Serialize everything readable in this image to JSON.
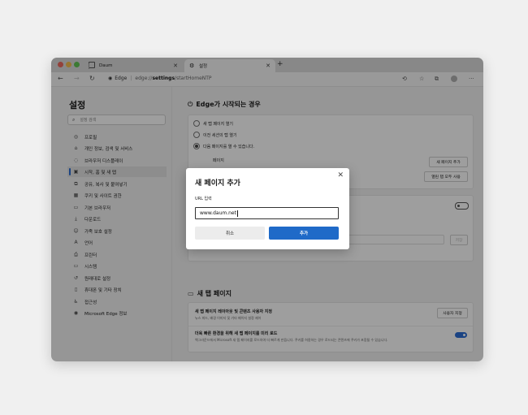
{
  "colors": {
    "accent": "#2b6cd4",
    "primary_button": "#1f6ac8",
    "mac_close": "#ed6a5e",
    "mac_min": "#f5bf4f",
    "mac_max": "#61c554"
  },
  "tabs": [
    {
      "title": "Daum",
      "icon": "daum-icon"
    },
    {
      "title": "설정",
      "icon": "settings-icon"
    }
  ],
  "address": {
    "browser_label": "Edge",
    "url_prefix": "edge://",
    "url_bold": "settings",
    "url_suffix": "/startHomeNTP"
  },
  "sidebar": {
    "title": "설정",
    "search_placeholder": "설정 검색",
    "items": [
      {
        "label": "프로필",
        "icon": "profile-icon"
      },
      {
        "label": "개인 정보, 검색 및 서비스",
        "icon": "lock-icon"
      },
      {
        "label": "브라우저 디스플레이",
        "icon": "display-icon"
      },
      {
        "label": "시작, 홈 및 새 탭",
        "icon": "home-icon"
      },
      {
        "label": "공유, 복사 및 붙여넣기",
        "icon": "share-icon"
      },
      {
        "label": "쿠키 및 사이트 권한",
        "icon": "cookie-icon"
      },
      {
        "label": "기본 브라우저",
        "icon": "browser-icon"
      },
      {
        "label": "다운로드",
        "icon": "download-icon"
      },
      {
        "label": "가족 보호 설정",
        "icon": "family-icon"
      },
      {
        "label": "언어",
        "icon": "language-icon"
      },
      {
        "label": "프린터",
        "icon": "printer-icon"
      },
      {
        "label": "시스템",
        "icon": "system-icon"
      },
      {
        "label": "원래대로 설정",
        "icon": "reset-icon"
      },
      {
        "label": "휴대폰 및 기타 장치",
        "icon": "phone-icon"
      },
      {
        "label": "접근성",
        "icon": "accessibility-icon"
      },
      {
        "label": "Microsoft Edge 정보",
        "icon": "edge-icon"
      }
    ]
  },
  "startup": {
    "title": "Edge가 시작되는 경우",
    "options": [
      "새 탭 페이지 열기",
      "이전 세션의 탭 열기",
      "다음 페이지를 열 수 있습니다."
    ],
    "pages_label": "페이지",
    "add_page_button": "새 페이지 추가",
    "use_all_tabs_button": "열린 탭 모두 사용"
  },
  "home": {
    "url_placeholder": "URL 입력",
    "save_button": "저장"
  },
  "newtab": {
    "title": "새 탭 페이지",
    "row1_title": "새 탭 페이지 레이아웃 및 콘텐츠 사용자 지정",
    "row1_sub": "뉴스 피드, 배경 이미지 및 기타 페이지 설정 제어",
    "row1_button": "사용자 지정",
    "row2_title": "더욱 빠른 환경을 위해 새 탭 페이지를 미리 로드",
    "row2_sub": "백그라운드에서 Microsoft 새 탭 페이지를 로드하여 더 빠르게 만듭니다. 쿠키를 허용하는 경우 로드되는 콘텐츠에 쿠키가 포함될 수 있습니다."
  },
  "dialog": {
    "title": "새 페이지 추가",
    "url_label": "URL 입력",
    "url_value": "www.daum.net",
    "cancel": "취소",
    "add": "추가"
  }
}
